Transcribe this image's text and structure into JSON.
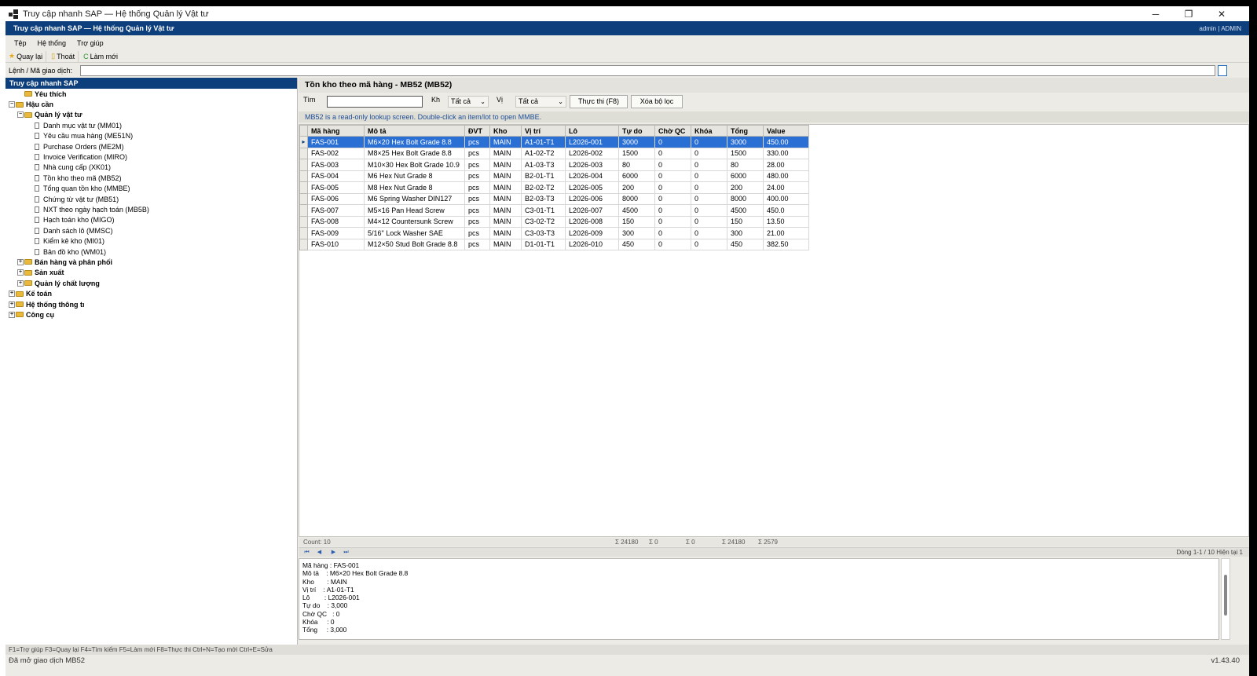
{
  "window": {
    "title": "Truy cập nhanh SAP — Hệ thống Quản lý Vật tư",
    "controls": [
      "─",
      "❐",
      "✕"
    ]
  },
  "app_header": {
    "title": "Truy cập nhanh SAP — Hệ thống Quản lý Vật tư",
    "user": "admin | ADMIN"
  },
  "menu": [
    "Tệp",
    "Hệ thống",
    "Trợ giúp"
  ],
  "toolbar": {
    "back": "Quay lại",
    "exit": "Thoát",
    "refresh": "Làm mới"
  },
  "command": {
    "label": "Lệnh / Mã giao dịch:",
    "value": ""
  },
  "tree": {
    "header": "Truy cập nhanh SAP",
    "nodes": [
      {
        "label": "Yêu thích",
        "level": 1,
        "type": "folder",
        "bold": true,
        "expander": ""
      },
      {
        "label": "Hậu cần",
        "level": 0,
        "type": "folder",
        "bold": true,
        "expander": "−"
      },
      {
        "label": "Quản lý vật tư",
        "level": 1,
        "type": "folder",
        "bold": true,
        "expander": "−"
      },
      {
        "label": "Danh mục vật tư (MM01)",
        "level": 2,
        "type": "doc"
      },
      {
        "label": "Yêu cầu mua hàng (ME51N)",
        "level": 2,
        "type": "doc"
      },
      {
        "label": "Purchase Orders (ME2M)",
        "level": 2,
        "type": "doc"
      },
      {
        "label": "Invoice Verification (MIRO)",
        "level": 2,
        "type": "doc"
      },
      {
        "label": "Nhà cung cấp (XK01)",
        "level": 2,
        "type": "doc"
      },
      {
        "label": "Tồn kho theo mã (MB52)",
        "level": 2,
        "type": "doc"
      },
      {
        "label": "Tổng quan tồn kho (MMBE)",
        "level": 2,
        "type": "doc"
      },
      {
        "label": "Chứng từ vật tư (MB51)",
        "level": 2,
        "type": "doc"
      },
      {
        "label": "NXT theo ngày hạch toán (MB5B)",
        "level": 2,
        "type": "doc"
      },
      {
        "label": "Hạch toán kho (MIGO)",
        "level": 2,
        "type": "doc"
      },
      {
        "label": "Danh sách lô (MMSC)",
        "level": 2,
        "type": "doc"
      },
      {
        "label": "Kiểm kê kho (MI01)",
        "level": 2,
        "type": "doc"
      },
      {
        "label": "Bản đồ kho (WM01)",
        "level": 2,
        "type": "doc"
      },
      {
        "label": "Bán hàng và phân phối",
        "level": 1,
        "type": "folder",
        "bold": true,
        "expander": "+"
      },
      {
        "label": "Sản xuất",
        "level": 1,
        "type": "folder",
        "bold": true,
        "expander": "+"
      },
      {
        "label": "Quản lý chất lượng",
        "level": 1,
        "type": "folder",
        "bold": true,
        "expander": "+"
      },
      {
        "label": "Kế toán",
        "level": 0,
        "type": "folder",
        "bold": true,
        "expander": "+"
      },
      {
        "label": "Hệ thống thông tı",
        "level": 0,
        "type": "folder",
        "bold": true,
        "expander": "+"
      },
      {
        "label": "Công cụ",
        "level": 0,
        "type": "folder",
        "bold": true,
        "expander": "+"
      }
    ]
  },
  "screen": {
    "title": "Tồn kho theo mã hàng - MB52  (MB52)",
    "filters": {
      "search_label": "Tìm",
      "search_value": "",
      "warehouse_label": "Kh",
      "warehouse_value": "Tất cả",
      "location_label": "Vị",
      "location_value": "Tất cả",
      "run_button": "Thực thi (F8)",
      "clear_button": "Xóa bộ lọc"
    },
    "info": "MB52 is a read-only lookup screen. Double-click an item/lot to open MMBE."
  },
  "grid": {
    "columns": [
      "Mã hàng",
      "Mô tả",
      "ĐVT",
      "Kho",
      "Vị trí",
      "Lô",
      "Tự do",
      "Chờ QC",
      "Khóa",
      "Tổng",
      "Value"
    ],
    "rows": [
      [
        "FAS-001",
        "M6×20 Hex Bolt Grade 8.8",
        "pcs",
        "MAIN",
        "A1-01-T1",
        "L2026-001",
        "3000",
        "0",
        "0",
        "3000",
        "450.00"
      ],
      [
        "FAS-002",
        "M8×25 Hex Bolt Grade 8.8",
        "pcs",
        "MAIN",
        "A1-02-T2",
        "L2026-002",
        "1500",
        "0",
        "0",
        "1500",
        "330.00"
      ],
      [
        "FAS-003",
        "M10×30 Hex Bolt Grade 10.9",
        "pcs",
        "MAIN",
        "A1-03-T3",
        "L2026-003",
        "80",
        "0",
        "0",
        "80",
        "28.00"
      ],
      [
        "FAS-004",
        "M6 Hex Nut Grade 8",
        "pcs",
        "MAIN",
        "B2-01-T1",
        "L2026-004",
        "6000",
        "0",
        "0",
        "6000",
        "480.00"
      ],
      [
        "FAS-005",
        "M8 Hex Nut Grade 8",
        "pcs",
        "MAIN",
        "B2-02-T2",
        "L2026-005",
        "200",
        "0",
        "0",
        "200",
        "24.00"
      ],
      [
        "FAS-006",
        "M6 Spring Washer DIN127",
        "pcs",
        "MAIN",
        "B2-03-T3",
        "L2026-006",
        "8000",
        "0",
        "0",
        "8000",
        "400.00"
      ],
      [
        "FAS-007",
        "M5×16 Pan Head Screw",
        "pcs",
        "MAIN",
        "C3-01-T1",
        "L2026-007",
        "4500",
        "0",
        "0",
        "4500",
        "450.0"
      ],
      [
        "FAS-008",
        "M4×12 Countersunk Screw",
        "pcs",
        "MAIN",
        "C3-02-T2",
        "L2026-008",
        "150",
        "0",
        "0",
        "150",
        "13.50"
      ],
      [
        "FAS-009",
        "5/16\" Lock Washer SAE",
        "pcs",
        "MAIN",
        "C3-03-T3",
        "L2026-009",
        "300",
        "0",
        "0",
        "300",
        "21.00"
      ],
      [
        "FAS-010",
        "M12×50 Stud Bolt Grade 8.8",
        "pcs",
        "MAIN",
        "D1-01-T1",
        "L2026-010",
        "450",
        "0",
        "0",
        "450",
        "382.50"
      ]
    ],
    "selected_row_marker": "▸"
  },
  "summary": {
    "count": "Count: 10",
    "sum_free": "Σ 24180",
    "sum_qc": "Σ 0",
    "sum_blocked": "Σ 0",
    "sum_total": "Σ 24180",
    "sum_value": "Σ 2579"
  },
  "navigation": {
    "buttons": [
      "⏮",
      "◀",
      "▶",
      "⏭"
    ],
    "page_info": "Dòng 1-1 / 10   Hiện tại 1"
  },
  "detail": [
    "Mã hàng : FAS-001",
    "Mô tả    : M6×20 Hex Bolt Grade 8.8",
    "Kho       : MAIN",
    "Vị trí    : A1-01-T1",
    "Lô        : L2026-001",
    "Tự do    : 3,000",
    "Chờ QC   : 0",
    "Khóa     : 0",
    "Tổng     : 3,000"
  ],
  "hotkeys": "F1=Trợ giúp  F3=Quay lại  F4=Tìm kiếm  F5=Làm mới  F8=Thực thi  Ctrl+N=Tạo mới  Ctrl+E=Sửa",
  "status": {
    "message": "Đã mở giao dịch MB52",
    "version": "v1.43.40"
  }
}
